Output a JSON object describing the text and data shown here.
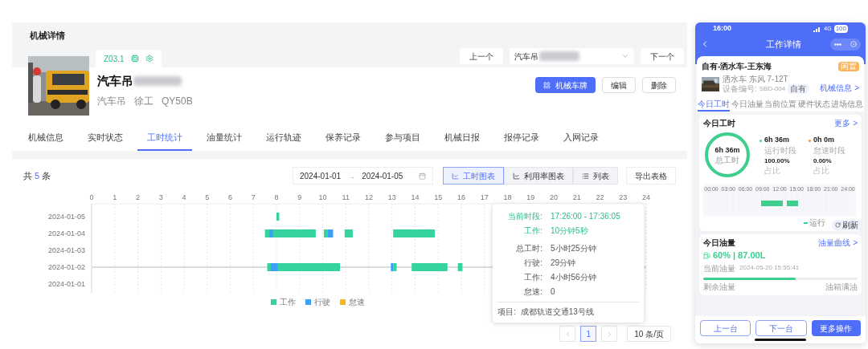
{
  "page_title": "机械详情",
  "machine": {
    "code": "Z03.1",
    "name": "汽车吊",
    "type": "汽车吊",
    "brand": "徐工",
    "model": "QY50B"
  },
  "switcher": {
    "prev": "上一个",
    "select_value": "汽车吊",
    "next": "下一个"
  },
  "actions": [
    {
      "label": "机械车牌",
      "kind": "primary"
    },
    {
      "label": "编辑",
      "kind": "default"
    },
    {
      "label": "删除",
      "kind": "default"
    }
  ],
  "tabs": [
    {
      "label": "机械信息",
      "selected": false
    },
    {
      "label": "实时状态",
      "selected": false
    },
    {
      "label": "工时统计",
      "selected": true
    },
    {
      "label": "油量统计",
      "selected": false
    },
    {
      "label": "运行轨迹",
      "selected": false
    },
    {
      "label": "保养记录",
      "selected": false
    },
    {
      "label": "参与项目",
      "selected": false
    },
    {
      "label": "机械日报",
      "selected": false
    },
    {
      "label": "报停记录",
      "selected": false
    },
    {
      "label": "入网记录",
      "selected": false
    }
  ],
  "panel": {
    "total_prefix": "共",
    "total": "5",
    "total_suffix": "条",
    "date_start": "2024-01-01",
    "date_arrow": "→",
    "date_end": "2024-01-05",
    "views": [
      {
        "label": "工时图表",
        "selected": true
      },
      {
        "label": "利用率图表",
        "selected": false
      },
      {
        "label": "列表",
        "selected": false
      }
    ],
    "export": "导出表格",
    "timeline": {
      "hour_ticks": [
        "0",
        "1",
        "2",
        "3",
        "4",
        "5",
        "6",
        "7",
        "8",
        "9",
        "10",
        "11",
        "12",
        "13",
        "14",
        "15",
        "16",
        "17",
        "18",
        "19",
        "20",
        "21",
        "22",
        "23",
        "24"
      ],
      "dates": [
        "2024-01-05",
        "2024-01-04",
        "2024-01-03",
        "2024-01-02",
        "2024-01-01"
      ],
      "legend": [
        {
          "label": "工作",
          "color": "#34d3a0"
        },
        {
          "label": "行驶",
          "color": "#3ba1f7"
        },
        {
          "label": "怠速",
          "color": "#fbb514"
        }
      ]
    },
    "tooltip": {
      "rows": [
        {
          "label": "当前时段:",
          "value": "17:26:00 - 17:36:05",
          "highlight": true
        },
        {
          "label": "工作:",
          "value": "10分钟5秒",
          "highlight": true
        },
        {
          "label": "总工时:",
          "value": "5小时25分钟",
          "highlight": false
        },
        {
          "label": "行驶:",
          "value": "29分钟",
          "highlight": false
        },
        {
          "label": "工作:",
          "value": "4小时56分钟",
          "highlight": false
        },
        {
          "label": "怠速:",
          "value": "0",
          "highlight": false
        }
      ],
      "project_label": "项目:",
      "project": "成都轨道交通13号线"
    },
    "pagination": {
      "pages": [
        {
          "label": "1",
          "selected": true
        }
      ],
      "page_size": "10 条/页"
    }
  },
  "mobile": {
    "status": {
      "time": "16:00",
      "network": "4G",
      "battery": "100"
    },
    "title": "工作详情",
    "machine": {
      "title": "自有-洒水车-王东海",
      "badge": "闲置",
      "spec": "洒水车 东风 7-12T",
      "code_label": "设备编号:",
      "code": "SBD-004",
      "tag": "自有",
      "link": "机械信息 >"
    },
    "tabs": [
      {
        "label": "今日工时",
        "selected": true
      },
      {
        "label": "今日油量",
        "selected": false
      },
      {
        "label": "当前位置",
        "selected": false
      },
      {
        "label": "硬件状态",
        "selected": false
      },
      {
        "label": "进场信息",
        "selected": false
      }
    ],
    "hours": {
      "title": "今日工时",
      "more": "更多 >",
      "ring": {
        "value": "6h 36m",
        "label": "总工时",
        "level": 1
      },
      "stats": [
        {
          "value": "6h 36m",
          "label": "运行时段",
          "color": "#34d399",
          "ratio": "100.00%",
          "ratio_label": "占比"
        },
        {
          "value": "0h 0m",
          "label": "怠速时段",
          "color": "#fb923c",
          "ratio": "0.00%",
          "ratio_label": "占比"
        }
      ],
      "ticks": [
        "00:00",
        "03:00",
        "06:00",
        "09:00",
        "12:00",
        "15:00",
        "18:00",
        "21:00",
        "24:00"
      ],
      "legend": [
        {
          "label": "运行",
          "color": "#34d399"
        }
      ],
      "refresh": "刷新"
    },
    "fuel": {
      "title": "今日油量",
      "link": "油量曲线 >",
      "percent": "60%",
      "separator": "|",
      "amount": "87.00L",
      "label": "当前油量",
      "time": "2024-05-20 15:55:41",
      "level": 0.6,
      "left_label": "剩余油量",
      "right_label": "油箱满油"
    },
    "buttons": [
      {
        "label": "上一台",
        "kind": "outline"
      },
      {
        "label": "下一台",
        "kind": "outline"
      },
      {
        "label": "更多操作",
        "kind": "primary"
      }
    ]
  }
}
